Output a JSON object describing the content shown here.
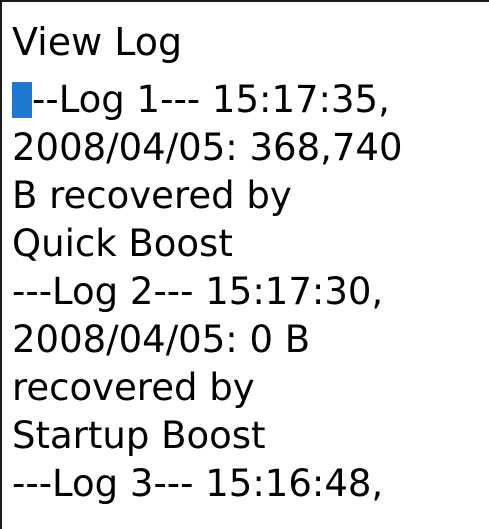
{
  "window": {
    "title": "View Log"
  },
  "log": {
    "lines": [
      "---Log 1--- 15:17:35,",
      "2008/04/05: 368,740",
      "B recovered by",
      "Quick Boost",
      "---Log 2--- 15:17:30,",
      "2008/04/05: 0 B",
      "recovered by",
      "Startup Boost",
      "---Log 3--- 15:16:48,"
    ],
    "cursor_color": "#1f78d1"
  }
}
